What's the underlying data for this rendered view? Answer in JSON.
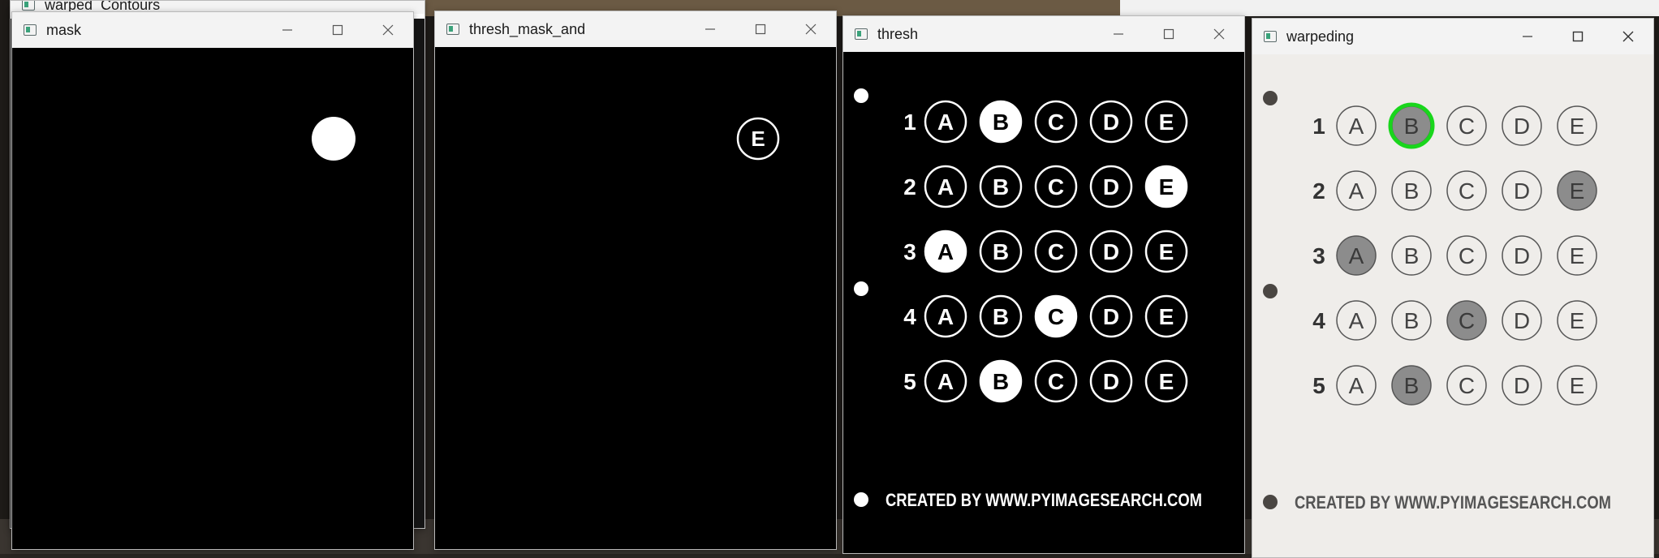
{
  "windows": {
    "back": {
      "title": "warped_Contours"
    },
    "mask": {
      "title": "mask"
    },
    "thresh_mask_and": {
      "title": "thresh_mask_and",
      "bubble_letter": "E"
    },
    "thresh": {
      "title": "thresh"
    },
    "warpeding": {
      "title": "warpeding"
    }
  },
  "sheet": {
    "question_numbers": [
      "1",
      "2",
      "3",
      "4",
      "5"
    ],
    "options": [
      "A",
      "B",
      "C",
      "D",
      "E"
    ],
    "filled": [
      1,
      4,
      0,
      2,
      1
    ],
    "highlighted": {
      "row": 0,
      "col": 1,
      "color": "#19d61c"
    },
    "footer": "CREATED BY WWW.PYIMAGESEARCH.COM"
  },
  "colors": {
    "titlebar": "#f3f3f3",
    "image_bg": "#000000",
    "paper": "#efedea",
    "fill_gray": "#8c8c8c",
    "highlight": "#19d61c"
  },
  "icons": [
    "app-icon",
    "minimize-icon",
    "maximize-icon",
    "close-icon"
  ]
}
